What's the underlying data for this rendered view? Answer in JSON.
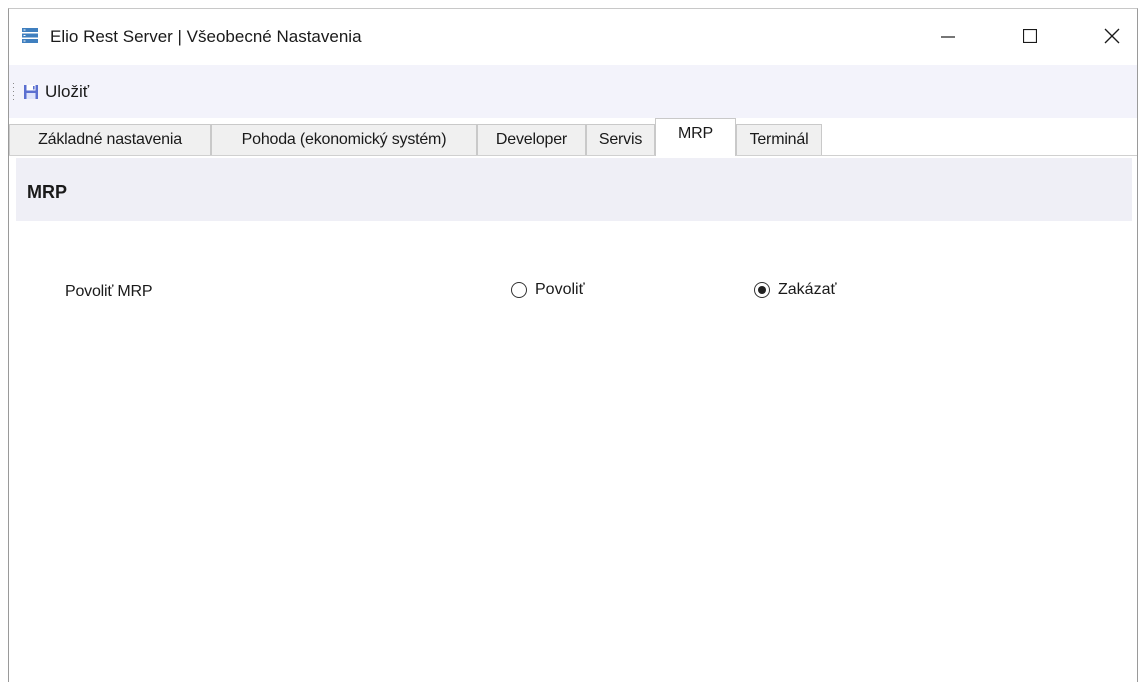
{
  "window": {
    "title": "Elio Rest Server | Všeobecné Nastavenia"
  },
  "toolbar": {
    "save_label": "Uložiť"
  },
  "tabs": [
    {
      "label": "Základné nastavenia",
      "active": false
    },
    {
      "label": "Pohoda (ekonomický systém)",
      "active": false
    },
    {
      "label": "Developer",
      "active": false
    },
    {
      "label": "Servis",
      "active": false
    },
    {
      "label": "MRP",
      "active": true
    },
    {
      "label": "Terminál",
      "active": false
    }
  ],
  "section": {
    "title": "MRP"
  },
  "mrp_setting": {
    "label": "Povoliť MRP",
    "options": [
      {
        "label": "Povoliť",
        "selected": false
      },
      {
        "label": "Zakázať",
        "selected": true
      }
    ]
  },
  "colors": {
    "toolbar_bg": "#f3f3fb",
    "section_header_bg": "#efeff6",
    "tab_inactive_bg": "#f0f0f0",
    "app_icon": "#3f7fbf"
  }
}
